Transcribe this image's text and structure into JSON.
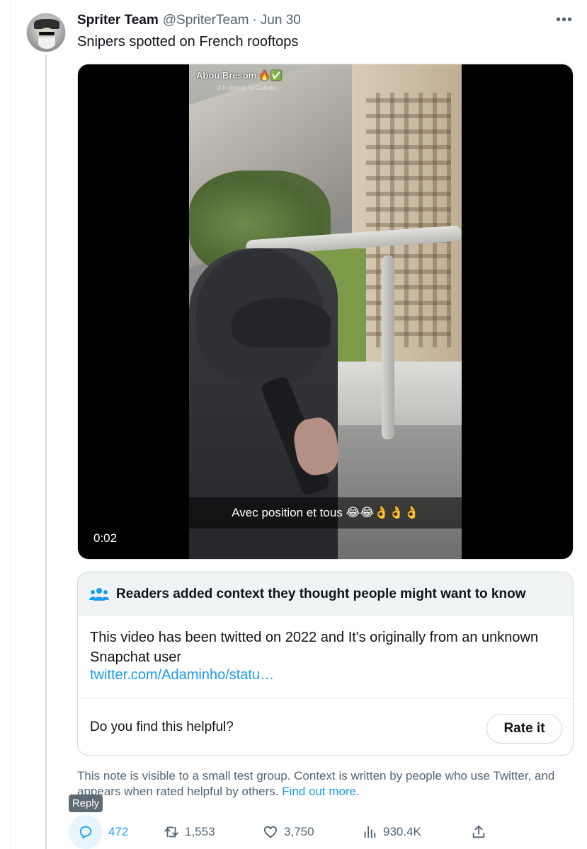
{
  "tweet": {
    "author_name": "Spriter Team",
    "author_handle": "@SpriterTeam",
    "separator": "·",
    "date": "Jun 30",
    "more_label": "•••",
    "text": "Snipers spotted on French rooftops"
  },
  "video": {
    "timestamp": "0:02",
    "caption": "Avec position et tous 😂😂👌👌👌",
    "watermark": "Abou Bresom 🔥✅",
    "watermark_sub": "3 h depuis la Galerie"
  },
  "community_note": {
    "title": "Readers added context they thought people might want to know",
    "body": "This video has been twitted on 2022 and It's originally from an unknown Snapchat user",
    "link": "twitter.com/Adaminho/statu…",
    "question": "Do you find this helpful?",
    "rate_label": "Rate it",
    "footnote": "This note is visible to a small test group. Context is written by people who use Twitter, and appears when rated helpful by others.",
    "footnote_link": "Find out more",
    "footnote_end": "."
  },
  "tooltip": "Reply",
  "actions": {
    "replies": "472",
    "retweets": "1,553",
    "likes": "3,750",
    "views": "930.4K"
  },
  "colors": {
    "accent": "#1d9bf0",
    "secondary_text": "#536471",
    "border": "#cfd9de"
  }
}
